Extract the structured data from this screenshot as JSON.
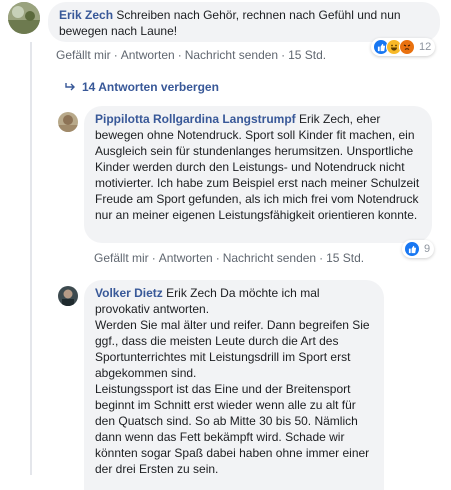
{
  "comment": {
    "author": "Erik Zech",
    "text": " Schreiben nach Gehör, rechnen nach Gefühl und nun bewegen nach Laune!",
    "actions": {
      "like": "Gefällt mir",
      "reply": "Antworten",
      "message": "Nachricht senden",
      "time": "15 Std."
    },
    "reaction_count": "12",
    "reactions": [
      "like-icon",
      "haha-icon",
      "angry-icon"
    ]
  },
  "replies_toggle": {
    "label": "14 Antworten verbergen",
    "icon": "reply-arrow-icon"
  },
  "reply1": {
    "author": "Pippilotta Rollgardina Langstrumpf",
    "text": " Erik Zech, eher bewegen ohne Notendruck. Sport soll Kinder fit machen, ein Ausgleich sein für stundenlanges herumsitzen. Unsportliche Kinder werden durch den Leistungs- und Notendruck nicht motivierter. Ich habe zum Beispiel erst nach meiner Schulzeit Freude am Sport gefunden, als ich mich frei vom Notendruck nur an meiner eigenen Leistungsfähigkeit orientieren konnte.",
    "actions": {
      "like": "Gefällt mir",
      "reply": "Antworten",
      "message": "Nachricht senden",
      "time": "15 Std."
    },
    "reaction_count": "9",
    "reactions": [
      "like-icon"
    ]
  },
  "reply2": {
    "author": "Volker Dietz",
    "line1": " Erik Zech Da möchte ich mal provokativ antworten.",
    "line2": "Werden Sie mal älter und reifer. Dann begreifen Sie ggf., dass die meisten Leute durch die Art des Sportunterrichtes mit Leistungsdrill im Sport erst abgekommen sind.",
    "line3": "Leistungssport ist das Eine und der Breitensport beginnt im Schnitt erst wieder wenn alle zu alt für den Quatsch sind. So ab Mitte 30 bis 50. Nämlich dann wenn das Fett bekämpft wird. Schade wir könnten sogar Spaß dabei haben ohne immer einer der drei Ersten zu sein."
  },
  "colors": {
    "link": "#385898",
    "bubble": "#f2f3f5",
    "meta": "#606770",
    "like": "#1877f2",
    "angry": "#e9710f",
    "haha": "#f7b928"
  }
}
